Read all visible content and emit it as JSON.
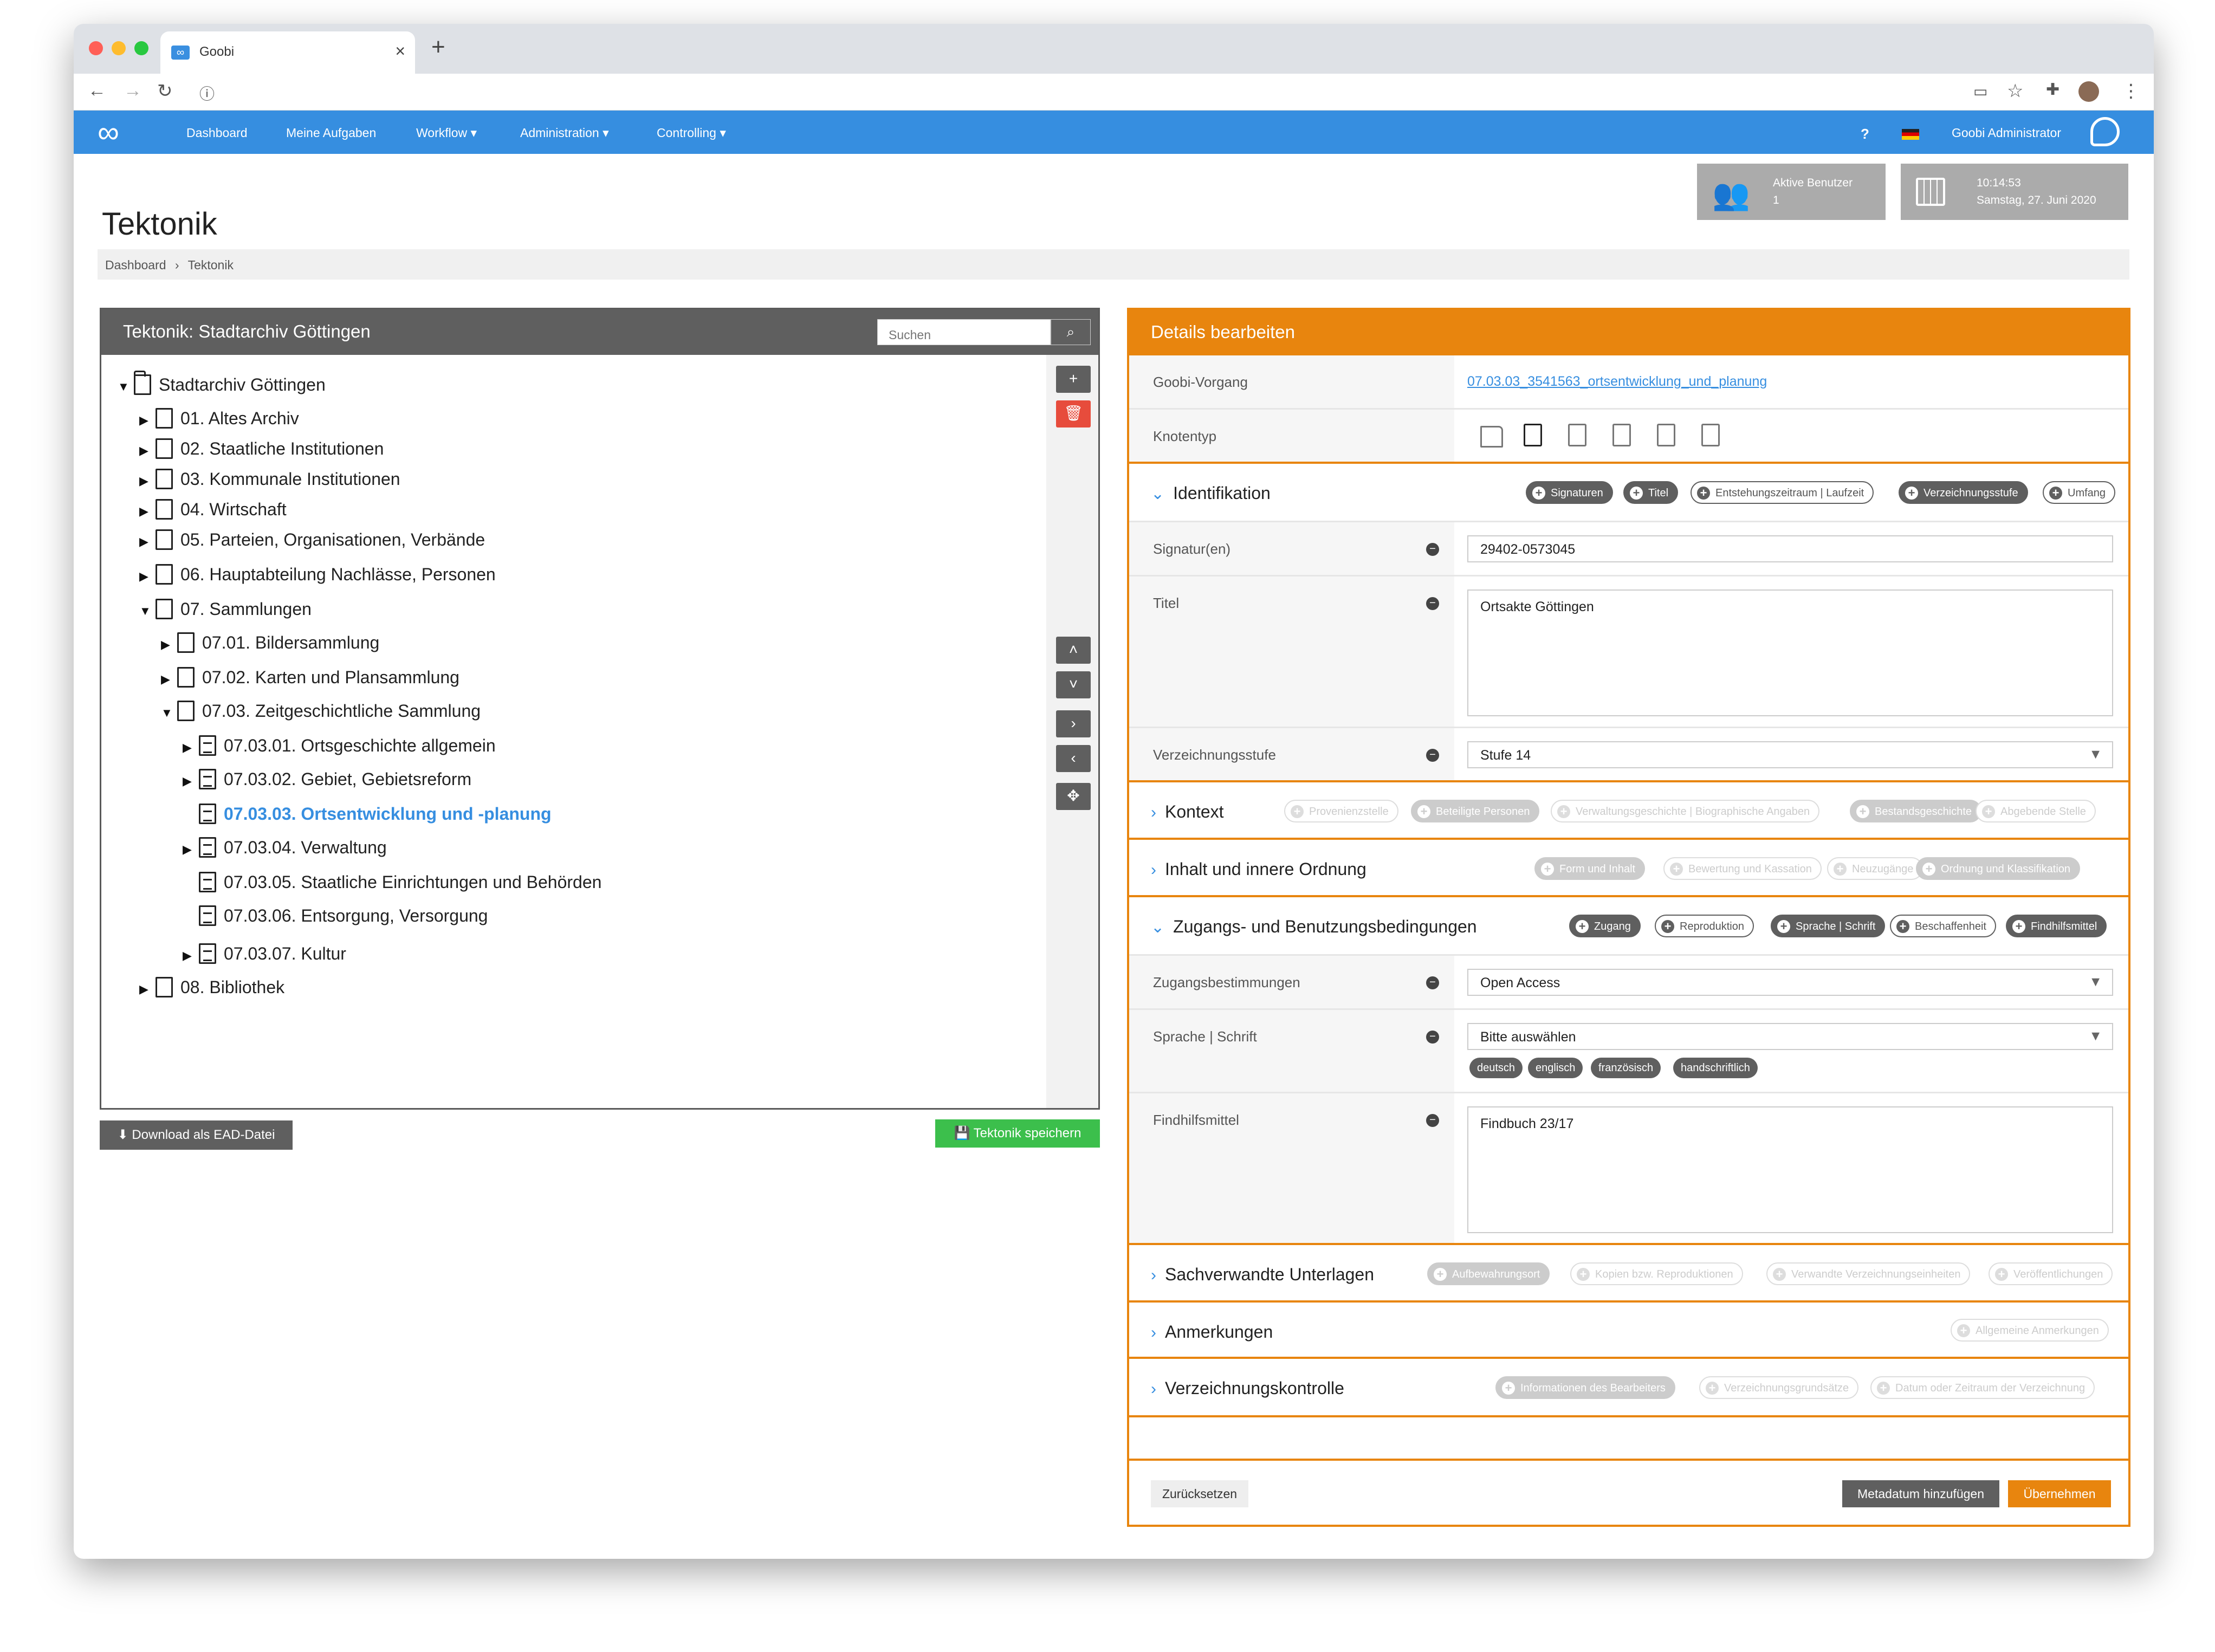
{
  "browser": {
    "tab_title": "Goobi",
    "new_tab": "+",
    "close": "×"
  },
  "nav": {
    "logo": "∞",
    "items": [
      "Dashboard",
      "Meine Aufgaben",
      "Workflow ▾",
      "Administration ▾",
      "Controlling ▾"
    ],
    "help": "?",
    "user": "Goobi Administrator"
  },
  "stats": {
    "users_label": "Aktive Benutzer",
    "users_count": "1",
    "time": "10:14:53",
    "date": "Samstag, 27. Juni 2020"
  },
  "page": {
    "title": "Tektonik",
    "breadcrumb": [
      "Dashboard",
      "Tektonik"
    ],
    "breadcrumb_sep": "›"
  },
  "left": {
    "header": "Tektonik: Stadtarchiv Göttingen",
    "search_placeholder": "Suchen",
    "tree": [
      "Stadtarchiv Göttingen",
      "01. Altes Archiv",
      "02. Staatliche Institutionen",
      "03. Kommunale Institutionen",
      "04. Wirtschaft",
      "05. Parteien, Organisationen, Verbände",
      "06. Hauptabteilung Nachlässe, Personen",
      "07. Sammlungen",
      "07.01. Bildersammlung",
      "07.02. Karten und Plansammlung",
      "07.03. Zeitgeschichtliche Sammlung",
      "07.03.01. Ortsgeschichte allgemein",
      "07.03.02. Gebiet, Gebietsreform",
      "07.03.03. Ortsentwicklung und -planung",
      "07.03.04. Verwaltung",
      "07.03.05. Staatliche Einrichtungen und Behörden",
      "07.03.06. Entsorgung, Versorgung",
      "07.03.07. Kultur",
      "08. Bibliothek"
    ],
    "download": "Download als EAD-Datei",
    "save": "Tektonik speichern"
  },
  "right": {
    "header": "Details bearbeiten",
    "goobi_label": "Goobi-Vorgang",
    "goobi_link": "07.03.03_3541563_ortsentwicklung_und_planung",
    "knoten_label": "Knotentyp",
    "ident": {
      "title": "Identifikation",
      "pills": [
        "Signaturen",
        "Titel",
        "Entstehungszeitraum | Laufzeit",
        "Verzeichnungsstufe",
        "Umfang"
      ],
      "sig_label": "Signatur(en)",
      "sig_value": "29402-0573045",
      "titel_label": "Titel",
      "titel_value": "Ortsakte Göttingen",
      "stufe_label": "Verzeichnungsstufe",
      "stufe_value": "Stufe 14"
    },
    "kontext": {
      "title": "Kontext",
      "pills": [
        "Provenienzstelle",
        "Beteiligte Personen",
        "Verwaltungsgeschichte | Biographische Angaben",
        "Bestandsgeschichte",
        "Abgebende Stelle"
      ]
    },
    "inhalt": {
      "title": "Inhalt und innere Ordnung",
      "pills": [
        "Form und Inhalt",
        "Bewertung und Kassation",
        "Neuzugänge",
        "Ordnung und Klassifikation"
      ]
    },
    "zugang": {
      "title": "Zugangs- und Benutzungsbedingungen",
      "pills": [
        "Zugang",
        "Reproduktion",
        "Sprache | Schrift",
        "Beschaffenheit",
        "Findhilfsmittel"
      ],
      "zb_label": "Zugangsbestimmungen",
      "zb_value": "Open Access",
      "sp_label": "Sprache | Schrift",
      "sp_value": "Bitte auswählen",
      "tags": [
        "deutsch",
        "englisch",
        "französisch",
        "handschriftlich"
      ],
      "fh_label": "Findhilfsmittel",
      "fh_value": "Findbuch 23/17"
    },
    "sach": {
      "title": "Sachverwandte Unterlagen",
      "pills": [
        "Aufbewahrungsort",
        "Kopien bzw. Reproduktionen",
        "Verwandte Verzeichnungseinheiten",
        "Veröffentlichungen"
      ]
    },
    "anm": {
      "title": "Anmerkungen",
      "pills": [
        "Allgemeine Anmerkungen"
      ]
    },
    "kontrolle": {
      "title": "Verzeichnungskontrolle",
      "pills": [
        "Informationen des Bearbeiters",
        "Verzeichnungsgrundsätze",
        "Datum oder Zeitraum der Verzeichnung"
      ]
    },
    "reset": "Zurücksetzen",
    "add_meta": "Metadatum hinzufügen",
    "apply": "Übernehmen"
  }
}
